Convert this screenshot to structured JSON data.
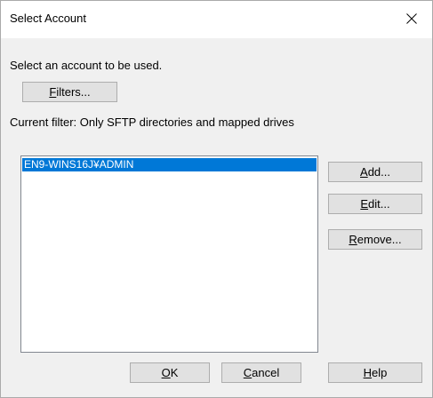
{
  "window": {
    "title": "Select Account"
  },
  "prompt": "Select an account to be used.",
  "filters_button": {
    "mnemonic": "F",
    "rest": "ilters..."
  },
  "current_filter": "Current filter: Only SFTP directories and mapped drives",
  "accounts": {
    "items": [
      {
        "label": "EN9-WINS16J¥ADMIN",
        "selected": true
      }
    ]
  },
  "side_buttons": {
    "add": {
      "mnemonic": "A",
      "rest": "dd..."
    },
    "edit": {
      "mnemonic": "E",
      "rest": "dit..."
    },
    "remove": {
      "mnemonic": "R",
      "rest": "emove..."
    }
  },
  "bottom_buttons": {
    "ok": {
      "mnemonic": "O",
      "rest": "K"
    },
    "cancel": {
      "mnemonic": "C",
      "rest": "ancel"
    },
    "help": {
      "mnemonic": "H",
      "rest": "elp"
    }
  },
  "colors": {
    "selection": "#0078d7",
    "button_face": "#e1e1e1",
    "dialog_bg": "#f0f0f0"
  },
  "icons": {
    "close": "close-icon"
  }
}
